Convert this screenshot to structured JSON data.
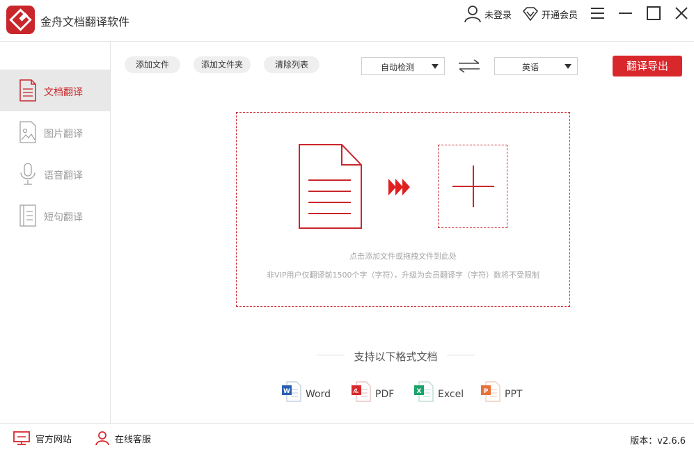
{
  "app": {
    "title": "金舟文档翻译软件",
    "accent_color": "#d8282c"
  },
  "header": {
    "login_label": "未登录",
    "vip_label": "开通会员",
    "icons": [
      "user-icon",
      "diamond-icon",
      "menu-icon",
      "minimize-icon",
      "maximize-icon",
      "close-icon"
    ]
  },
  "sidebar": {
    "items": [
      {
        "label": "文档翻译",
        "icon": "document-icon",
        "active": true
      },
      {
        "label": "图片翻译",
        "icon": "image-icon",
        "active": false
      },
      {
        "label": "语音翻译",
        "icon": "microphone-icon",
        "active": false
      },
      {
        "label": "短句翻译",
        "icon": "sentence-icon",
        "active": false
      }
    ]
  },
  "toolbar": {
    "add_file": "添加文件",
    "add_folder": "添加文件夹",
    "clear_list": "清除列表",
    "source_lang": "自动检测",
    "target_lang": "英语",
    "export_label": "翻译导出"
  },
  "dropzone": {
    "hint": "点击添加文件或拖拽文件到此处",
    "notice": "非VIP用户仅翻译前1500个字（字符），升级为会员翻译字（字符）数将不受限制"
  },
  "formats": {
    "title": "支持以下格式文档",
    "items": [
      {
        "label": "Word",
        "icon": "word-icon",
        "color": "#2b5fb4"
      },
      {
        "label": "PDF",
        "icon": "pdf-icon",
        "color": "#d8282c"
      },
      {
        "label": "Excel",
        "icon": "excel-icon",
        "color": "#1aa36b"
      },
      {
        "label": "PPT",
        "icon": "ppt-icon",
        "color": "#e8703a"
      }
    ]
  },
  "statusbar": {
    "website": "官方网站",
    "service": "在线客服",
    "version": "版本：v2.6.6"
  }
}
